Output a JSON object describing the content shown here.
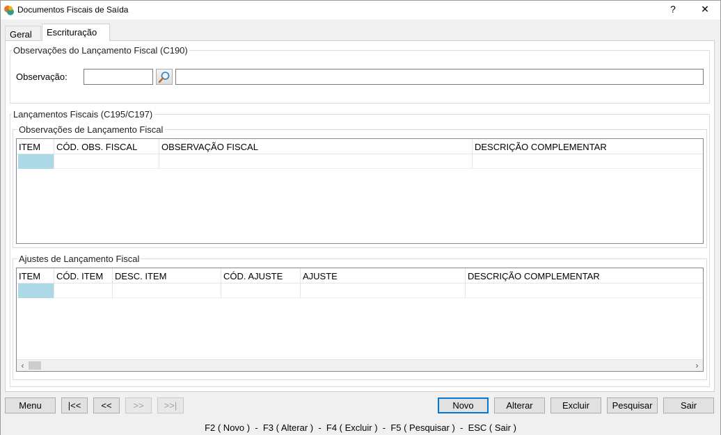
{
  "window": {
    "title": "Documentos Fiscais de Saída",
    "help_label": "?",
    "close_label": "✕"
  },
  "tabs": [
    {
      "label": "Geral",
      "active": false
    },
    {
      "label": "Escrituração",
      "active": true
    }
  ],
  "obs_group": {
    "legend": "Observações do Lançamento Fiscal (C190)",
    "field_label": "Observação:",
    "code_value": "",
    "desc_value": ""
  },
  "lanc_group": {
    "legend": "Lançamentos Fiscais (C195/C197)",
    "obs_sub": {
      "legend": "Observações de Lançamento Fiscal",
      "columns": [
        "ITEM",
        "CÓD. OBS. FISCAL",
        "OBSERVAÇÃO FISCAL",
        "DESCRIÇÃO COMPLEMENTAR"
      ]
    },
    "ajustes_sub": {
      "legend": "Ajustes de Lançamento Fiscal",
      "columns": [
        "ITEM",
        "CÓD. ITEM",
        "DESC. ITEM",
        "CÓD. AJUSTE",
        "AJUSTE",
        "DESCRIÇÃO COMPLEMENTAR"
      ]
    }
  },
  "buttons": {
    "menu": "Menu",
    "first": "|<<",
    "prev": "<<",
    "next": ">>",
    "last": ">>|",
    "novo": "Novo",
    "alterar": "Alterar",
    "excluir": "Excluir",
    "pesquisar": "Pesquisar",
    "sair": "Sair"
  },
  "shortcuts": "F2 ( Novo )  -  F3 ( Alterar )  -  F4 ( Excluir )  -  F5 ( Pesquisar )  -  ESC ( Sair )",
  "colors": {
    "selected_cell": "#add8e6",
    "default_button_border": "#0078d7"
  }
}
